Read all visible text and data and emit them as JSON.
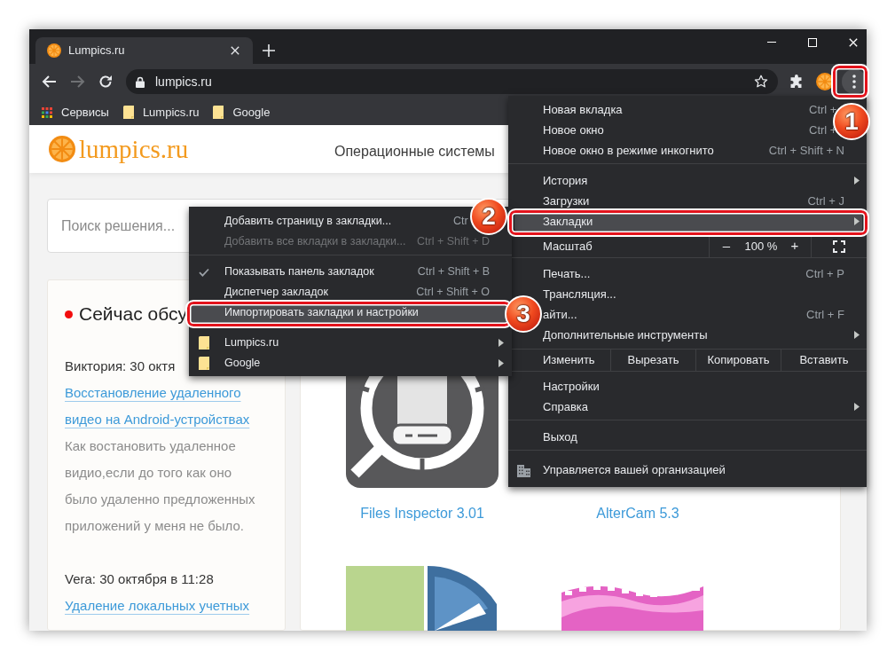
{
  "tabs": [
    {
      "title": "Lumpics.ru",
      "selected": true
    }
  ],
  "nav_buttons": [
    {
      "kind": "back",
      "disabled": false
    },
    {
      "kind": "forward",
      "disabled": true
    },
    {
      "kind": "reload",
      "disabled": false
    }
  ],
  "address_bar": {
    "url": "lumpics.ru"
  },
  "menu_button": {
    "pressed": true,
    "badge": "1"
  },
  "bookmarks_bar": [
    {
      "kind": "apps",
      "label": "Сервисы"
    },
    {
      "kind": "folder",
      "label": "Lumpics.ru"
    },
    {
      "kind": "folder",
      "label": "Google"
    }
  ],
  "page": {
    "logo": "lumpics.ru",
    "nav": [
      "Операционные системы"
    ],
    "search": {
      "placeholder": "Поиск решения..."
    },
    "discussion": {
      "title": "Сейчас обсу",
      "comments": [
        {
          "author": "Виктория: 30 октя",
          "link": "Восстановление удаленного видео на Android-устройствах",
          "text": "Как востановить удаленное видио,если до того как оно было удаленно предложенных приложений у меня не было."
        },
        {
          "author": "Vera: 30 октября в 11:28",
          "link": "Удаление локальных учетных"
        }
      ]
    },
    "programs": [
      {
        "name": "Files Inspector 3.01"
      },
      {
        "name": "AlterCam 5.3"
      }
    ]
  },
  "app_menu": {
    "items": [
      {
        "kind": "item",
        "label": "Новая вкладка",
        "shortcut": "Ctrl +",
        "submenu": false,
        "selected": false
      },
      {
        "kind": "item",
        "label": "Новое окно",
        "shortcut": "Ctrl +",
        "submenu": false,
        "selected": false
      },
      {
        "kind": "item",
        "label": "Новое окно в режиме инкогнито",
        "shortcut": "Ctrl + Shift + N",
        "submenu": false,
        "selected": false
      },
      {
        "kind": "separator"
      },
      {
        "kind": "item",
        "label": "История",
        "submenu": true,
        "selected": false
      },
      {
        "kind": "item",
        "label": "Загрузки",
        "shortcut": "Ctrl + J",
        "submenu": false,
        "selected": false
      },
      {
        "kind": "item",
        "label": "Закладки",
        "submenu": true,
        "selected": true,
        "badge": "2"
      },
      {
        "kind": "zoom",
        "label": "Масштаб",
        "minus": "–",
        "level_text": "100 %",
        "plus": "+"
      },
      {
        "kind": "item",
        "label": "Печать...",
        "shortcut": "Ctrl + P",
        "submenu": false,
        "selected": false
      },
      {
        "kind": "item",
        "label": "Трансляция...",
        "submenu": false,
        "selected": false
      },
      {
        "kind": "item",
        "label": "айти...",
        "shortcut": "Ctrl + F",
        "submenu": false,
        "selected": false
      },
      {
        "kind": "item",
        "label": "Дополнительные инструменты",
        "submenu": true,
        "selected": false
      },
      {
        "kind": "edit",
        "label": "Изменить",
        "buttons": [
          "Вырезать",
          "Копировать",
          "Вставить"
        ]
      },
      {
        "kind": "item",
        "label": "Настройки",
        "submenu": false,
        "selected": false
      },
      {
        "kind": "item",
        "label": "Справка",
        "submenu": true,
        "selected": false
      },
      {
        "kind": "separator"
      },
      {
        "kind": "item",
        "label": "Выход",
        "submenu": false,
        "selected": false
      },
      {
        "kind": "separator"
      },
      {
        "kind": "managed",
        "label": "Управляется вашей организацией"
      }
    ]
  },
  "bookmarks_submenu": {
    "items": [
      {
        "kind": "item",
        "label": "Добавить страницу в закладки...",
        "shortcut": "Ctr",
        "checked": false,
        "disabled": false,
        "submenu": false,
        "selected": false
      },
      {
        "kind": "item",
        "label": "Добавить все вкладки в закладки...",
        "shortcut": "Ctrl + Shift + D",
        "checked": false,
        "disabled": true,
        "submenu": false,
        "selected": false
      },
      {
        "kind": "separator"
      },
      {
        "kind": "item",
        "label": "Показывать панель закладок",
        "shortcut": "Ctrl + Shift + B",
        "checked": true,
        "disabled": false,
        "submenu": false,
        "selected": false
      },
      {
        "kind": "item",
        "label": "Диспетчер закладок",
        "shortcut": "Ctrl + Shift + O",
        "checked": false,
        "disabled": false,
        "submenu": false,
        "selected": false
      },
      {
        "kind": "item",
        "label": "Импортировать закладки и настройки",
        "checked": false,
        "disabled": false,
        "submenu": false,
        "selected": true,
        "badge": "3"
      },
      {
        "kind": "separator"
      },
      {
        "kind": "folder",
        "label": "Lumpics.ru",
        "disabled": false,
        "submenu": true,
        "selected": false
      },
      {
        "kind": "folder",
        "label": "Google",
        "disabled": false,
        "submenu": true,
        "selected": false
      }
    ]
  }
}
